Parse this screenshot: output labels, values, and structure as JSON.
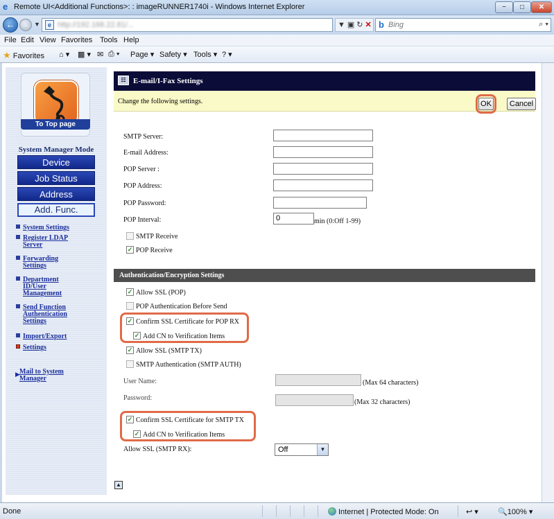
{
  "window": {
    "title": "Remote UI<Additional Functions>: : imageRUNNER1740i - Windows Internet Explorer",
    "min": "−",
    "max": "□",
    "close": "✕"
  },
  "address": {
    "url": "http://192.168.22.81/...",
    "search_placeholder": "Bing",
    "search_icon": "⌕ ▾"
  },
  "menu": [
    "File",
    "Edit",
    "View",
    "Favorites",
    "Tools",
    "Help"
  ],
  "favbar": {
    "favorites": "Favorites",
    "page": "Page ▾",
    "safety": "Safety ▾",
    "tools": "Tools ▾",
    "help": "? ▾"
  },
  "sidebar": {
    "to_top": "To Top page",
    "mode_label": "System Manager Mode",
    "modes": [
      "Device",
      "Job Status",
      "Address",
      "Add. Func."
    ],
    "links": [
      {
        "label": "System Settings"
      },
      {
        "label": "Register LDAP Server"
      },
      {
        "label": "Forwarding Settings"
      },
      {
        "label": "Department ID/User Management"
      },
      {
        "label": "Send Function Authentication Settings"
      },
      {
        "label": "Import/Export"
      },
      {
        "label": "Settings"
      }
    ],
    "mail_link": "Mail to System Manager"
  },
  "main": {
    "title": "E-mail/I-Fax Settings",
    "info": "Change the following settings.",
    "ok": "OK",
    "cancel": "Cancel",
    "fields": {
      "smtp_server": "SMTP Server:",
      "email_address": "E-mail Address:",
      "pop_server": "POP Server :",
      "pop_address": "POP Address:",
      "pop_password": "POP Password:",
      "pop_interval": "POP Interval:",
      "pop_interval_value": "0",
      "pop_interval_hint": "min (0:Off 1-99)"
    },
    "checks": {
      "smtp_receive": "SMTP Receive",
      "pop_receive": "POP Receive",
      "allow_ssl_pop": "Allow SSL (POP)",
      "pop_auth_before_send": "POP Authentication Before Send",
      "confirm_ssl_pop_rx": "Confirm SSL Certificate for POP RX",
      "add_cn_pop": "Add CN to Verification Items",
      "allow_ssl_smtp_tx": "Allow SSL (SMTP TX)",
      "smtp_auth": "SMTP Authentication (SMTP AUTH)",
      "confirm_ssl_smtp_tx": "Confirm SSL Certificate for SMTP TX",
      "add_cn_smtp": "Add CN to Verification Items"
    },
    "auth_section": "Authentication/Encryption Settings",
    "user_name": "User Name:",
    "user_name_hint": "(Max 64 characters)",
    "password": "Password:",
    "password_hint": "(Max 32 characters)",
    "allow_ssl_smtp_rx": "Allow SSL (SMTP RX):",
    "allow_ssl_smtp_rx_value": "Off",
    "check_mark": "✓"
  },
  "status": {
    "left": "Done",
    "zone": "Internet | Protected Mode: On",
    "zoom": "🔍100%  ▾",
    "security": "↩ ▾"
  }
}
